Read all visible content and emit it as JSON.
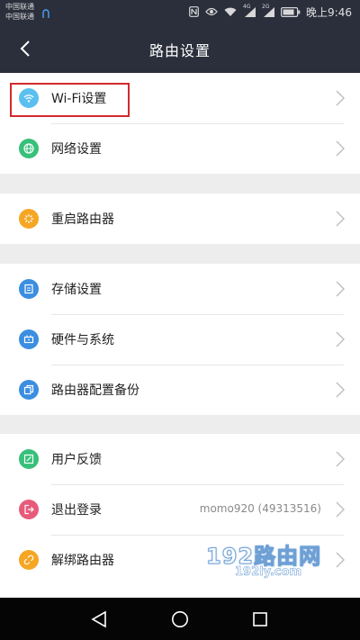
{
  "status_bar": {
    "carrier1": "中国联通",
    "carrier2": "中国联通",
    "signal1": "4G",
    "signal2": "2G",
    "time": "晚上9:46"
  },
  "header": {
    "title": "路由设置",
    "back_icon": "back-arrow-icon"
  },
  "groups": [
    {
      "items": [
        {
          "label": "Wi-Fi设置",
          "icon": "wifi-icon",
          "color": "#5bc0f0"
        },
        {
          "label": "网络设置",
          "icon": "globe-icon",
          "color": "#37c07a"
        }
      ]
    },
    {
      "items": [
        {
          "label": "重启路由器",
          "icon": "restart-icon",
          "color": "#f5a623"
        }
      ]
    },
    {
      "items": [
        {
          "label": "存储设置",
          "icon": "storage-icon",
          "color": "#3b8ee0"
        },
        {
          "label": "硬件与系统",
          "icon": "hardware-icon",
          "color": "#3b8ee0"
        },
        {
          "label": "路由器配置备份",
          "icon": "backup-icon",
          "color": "#3b8ee0"
        }
      ]
    },
    {
      "items": [
        {
          "label": "用户反馈",
          "icon": "feedback-icon",
          "color": "#37c07a"
        },
        {
          "label": "退出登录",
          "icon": "logout-icon",
          "color": "#e85a7a",
          "value": "momo920 (49313516)"
        },
        {
          "label": "解绑路由器",
          "icon": "unbind-icon",
          "color": "#f5a623"
        }
      ]
    }
  ],
  "watermark": {
    "main": "192路由网",
    "sub": "192ly.com"
  },
  "system_nav": {
    "back": "triangle-back-icon",
    "home": "circle-home-icon",
    "recent": "square-recents-icon"
  }
}
